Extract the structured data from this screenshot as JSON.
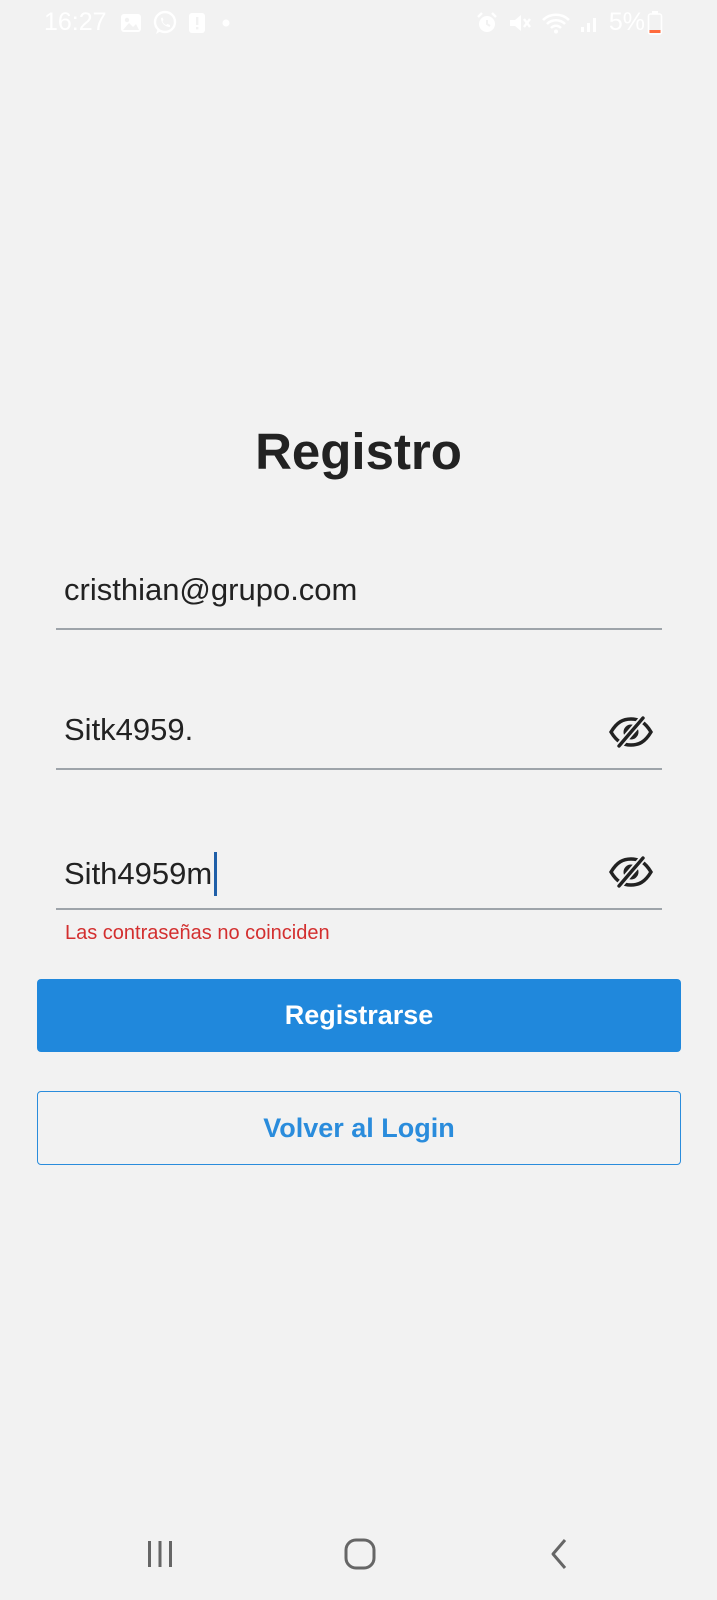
{
  "status_bar": {
    "time": "16:27",
    "left_icons": [
      "gallery-icon",
      "whatsapp-icon",
      "notification-icon",
      "dot-icon"
    ],
    "right_icons": [
      "alarm-icon",
      "mute-icon",
      "wifi-icon",
      "signal-icon"
    ],
    "battery": "5%",
    "battery_color": "#ff6b3d"
  },
  "title": "Registro",
  "form": {
    "email_value": "cristhian@grupo.com",
    "password_value": "Sitk4959.",
    "confirm_value": "Sith4959m",
    "toggle_icon": "eye-off-icon",
    "error": "Las contraseñas no coinciden"
  },
  "buttons": {
    "register_label": "Registrarse",
    "back_label": "Volver al Login",
    "primary_color": "#2088dc"
  },
  "nav": {
    "recents_icon": "recents-icon",
    "home_icon": "home-icon",
    "back_icon": "back-icon"
  }
}
